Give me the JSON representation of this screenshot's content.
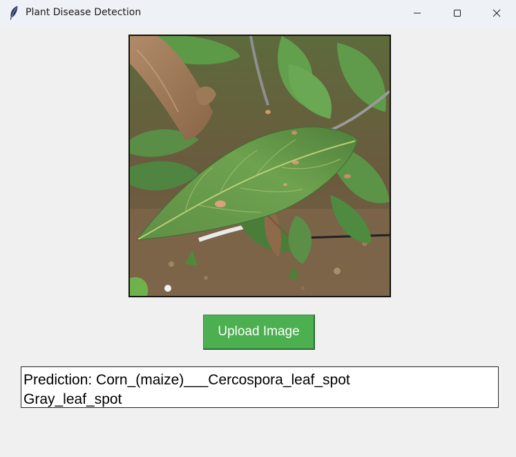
{
  "window": {
    "title": "Plant Disease Detection",
    "app_icon": "feather-icon",
    "controls": {
      "minimize_icon": "minimize-icon",
      "maximize_icon": "maximize-icon",
      "close_icon": "close-icon"
    }
  },
  "image_panel": {
    "content": "photo of green leaf with brown spots"
  },
  "upload_button": {
    "label": "Upload Image",
    "color": "#4caf50"
  },
  "prediction": {
    "line1": "Prediction: Corn_(maize)___Cercospora_leaf_spot",
    "line2": "Gray_leaf_spot"
  }
}
